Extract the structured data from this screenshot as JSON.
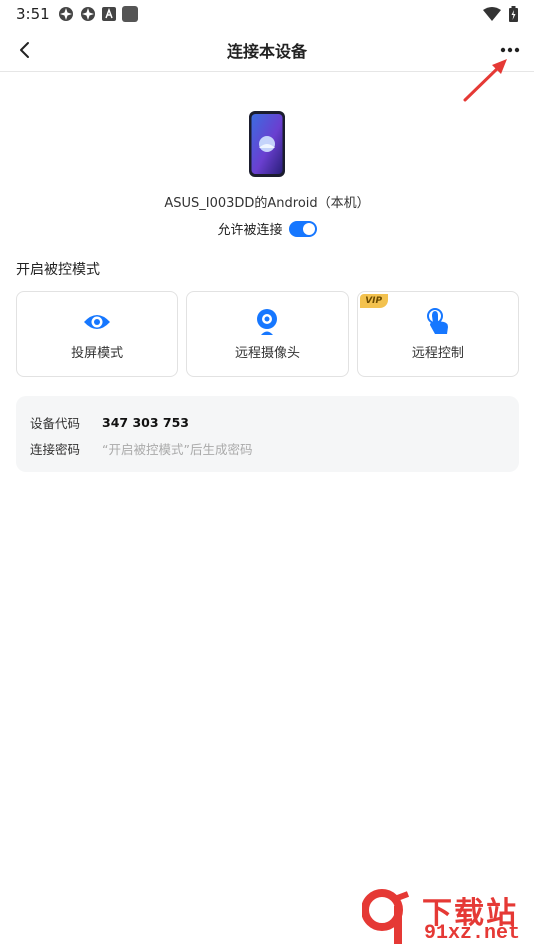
{
  "status_bar": {
    "time": "3:51",
    "left_icons": [
      "clover-app-icon",
      "clover-app-icon",
      "font-a-icon",
      "square-app-icon"
    ],
    "right_icons": [
      "wifi-icon",
      "battery-charging-icon"
    ]
  },
  "header": {
    "title": "连接本设备",
    "back_icon": "chevron-left-icon",
    "more_icon": "more-dots-icon"
  },
  "device": {
    "name": "ASUS_I003DD的Android（本机）",
    "allow_label": "允许被连接",
    "allow_enabled": true
  },
  "mode_section": {
    "title": "开启被控模式",
    "modes": [
      {
        "label": "投屏模式",
        "icon": "eye-icon",
        "vip": false
      },
      {
        "label": "远程摄像头",
        "icon": "webcam-icon",
        "vip": false
      },
      {
        "label": "远程控制",
        "icon": "touch-hand-icon",
        "vip": true,
        "badge": "VIP"
      }
    ]
  },
  "info": {
    "code_label": "设备代码",
    "code_value": "347 303 753",
    "password_label": "连接密码",
    "password_hint": "“开启被控模式”后生成密码"
  },
  "watermark": {
    "logo_text": "91",
    "title": "下载站",
    "domain": "91xz.net"
  },
  "colors": {
    "accent": "#1677ff",
    "vip": "#f3c24f",
    "annotation_arrow": "#e53935"
  }
}
